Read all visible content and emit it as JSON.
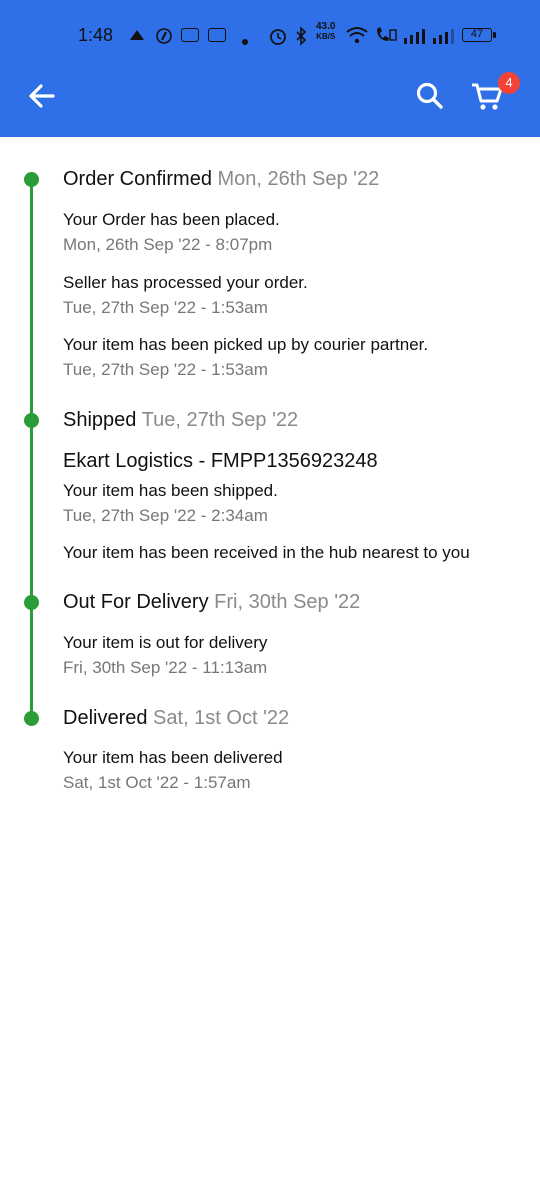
{
  "status_bar": {
    "time": "1:48",
    "speed_top": "43.0",
    "speed_unit": "KB/S",
    "battery": "47"
  },
  "header": {
    "cart_count": "4",
    "icons": [
      "back-arrow-icon",
      "search-icon",
      "cart-icon"
    ]
  },
  "timeline": {
    "sections": [
      {
        "title": "Order Confirmed",
        "date": "Mon, 26th Sep '22",
        "events": [
          {
            "message": "Your Order has been placed.",
            "time": "Mon, 26th Sep '22 - 8:07pm"
          },
          {
            "message": "Seller has processed your order.",
            "time": "Tue, 27th Sep '22 - 1:53am"
          },
          {
            "message": "Your item has been picked up by courier partner.",
            "time": "Tue, 27th Sep '22 - 1:53am"
          }
        ]
      },
      {
        "title": "Shipped",
        "date": "Tue, 27th Sep '22",
        "courier": "Ekart Logistics - FMPP1356923248",
        "events": [
          {
            "message": "Your item has been shipped.",
            "time": "Tue, 27th Sep '22 - 2:34am"
          },
          {
            "message": "Your item has been received in the hub nearest to you"
          }
        ]
      },
      {
        "title": "Out For Delivery",
        "date": "Fri, 30th Sep '22",
        "events": [
          {
            "message": "Your item is out for delivery",
            "time": "Fri, 30th Sep '22 - 11:13am"
          }
        ]
      },
      {
        "title": "Delivered",
        "date": "Sat, 1st Oct '22",
        "events": [
          {
            "message": "Your item has been delivered",
            "time": "Sat, 1st Oct '22 - 1:57am"
          }
        ]
      }
    ]
  },
  "colors": {
    "primary": "#2f6fe8",
    "timeline_green": "#2a9d36",
    "badge_red": "#f44336",
    "muted_text": "#8a8a8a"
  }
}
